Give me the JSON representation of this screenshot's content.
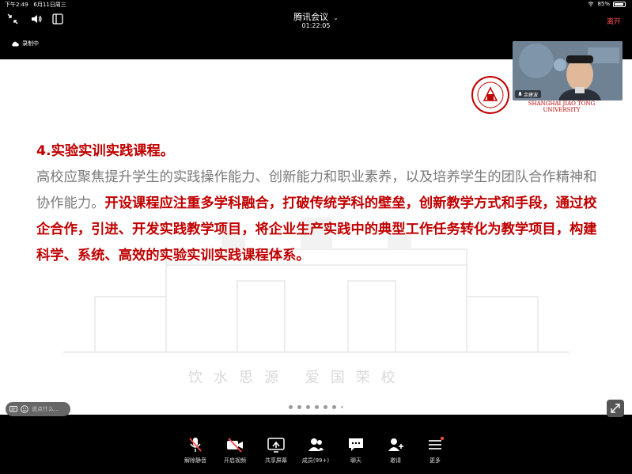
{
  "status_bar": {
    "time": "下午2:49",
    "date": "6月11日周三",
    "battery": "85%"
  },
  "meeting": {
    "title": "腾讯会议",
    "timer": "01:22:05",
    "leave_label": "离开"
  },
  "recording": {
    "label": "录制中"
  },
  "slide": {
    "heading": "4.实验实训实践课程。",
    "para_normal": "高校应聚焦提升学生的实践操作能力、创新能力和职业素养，以及培养学生的团队合作精神和协作能力。",
    "para_highlight": "开设课程应注重多学科融合，打破传统学科的壁垒，创新教学方式和手段，通过校企合作，引进、开发实践教学项目，将企业生产实践中的典型工作任务转化为教学项目，构建科学、系统、高效的实验实训实践课程体系。",
    "slogan": "饮水思源 爱国荣校",
    "university_name": "SHANGHAI JIAO TONG UNIVERSITY"
  },
  "speaker": {
    "name": "余建波"
  },
  "chat": {
    "placeholder": "说点什么..."
  },
  "pager": {
    "dot_count": 7
  },
  "toolbar": {
    "mute": "解除静音",
    "video": "开启视频",
    "share": "共享屏幕",
    "members": "成员(99+)",
    "chat": "聊天",
    "invite": "邀请",
    "more": "更多"
  },
  "colors": {
    "accent_red": "#c00000",
    "leave_red": "#ff4d4f",
    "slide_gray": "#7a7a7a"
  },
  "icons": [
    "collapse-icon",
    "speaker-icon",
    "chevron-down-icon",
    "cloud-icon",
    "mic-muted-icon",
    "video-off-icon",
    "share-screen-icon",
    "members-icon",
    "chat-bubble-icon",
    "invite-icon",
    "more-menu-icon",
    "fullscreen-icon",
    "comment-icon",
    "smile-icon"
  ]
}
